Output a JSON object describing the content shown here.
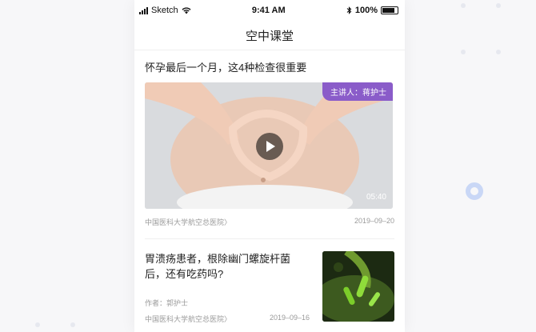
{
  "status_bar": {
    "carrier": "Sketch",
    "time": "9:41 AM",
    "battery": "100%"
  },
  "nav": {
    "title": "空中课堂"
  },
  "articles": [
    {
      "title": "怀孕最后一个月，这4种检查很重要",
      "speaker": "主讲人：蒋护士",
      "duration": "05:40",
      "source": "中国医科大学航空总医院〉",
      "date": "2019–09–20"
    },
    {
      "title": "胃溃疡患者，根除幽门螺旋杆菌后，还有吃药吗?",
      "author": "作者：郭护士",
      "source": "中国医科大学航空总医院〉",
      "date": "2019–09–16"
    }
  ],
  "colors": {
    "speaker_badge": "#8a5cc9",
    "ring": "#c9d7f6"
  },
  "icons": [
    "signal-icon",
    "wifi-icon",
    "bluetooth-icon",
    "battery-icon",
    "play-icon"
  ]
}
